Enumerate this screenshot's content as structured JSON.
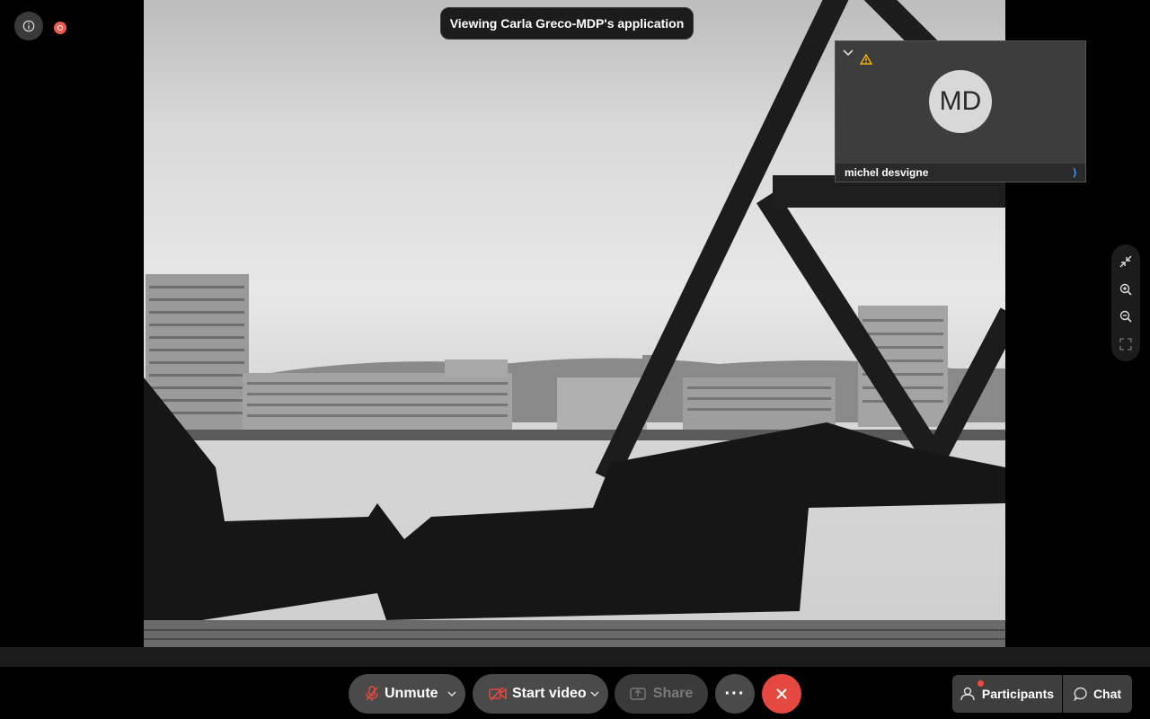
{
  "banner": {
    "text": "Viewing Carla Greco-MDP's application"
  },
  "participant_tile": {
    "initials": "MD",
    "name": "michel desvigne",
    "network_indicator": ")"
  },
  "toolbar": {
    "unmute_label": "Unmute",
    "video_label": "Start video",
    "share_label": "Share",
    "more_label": "···",
    "participants_label": "Participants",
    "chat_label": "Chat"
  },
  "colors": {
    "end_call": "#e5483e",
    "recording": "#ef5a4f",
    "warning": "#f5b700",
    "mic_muted": "#e5483e"
  }
}
